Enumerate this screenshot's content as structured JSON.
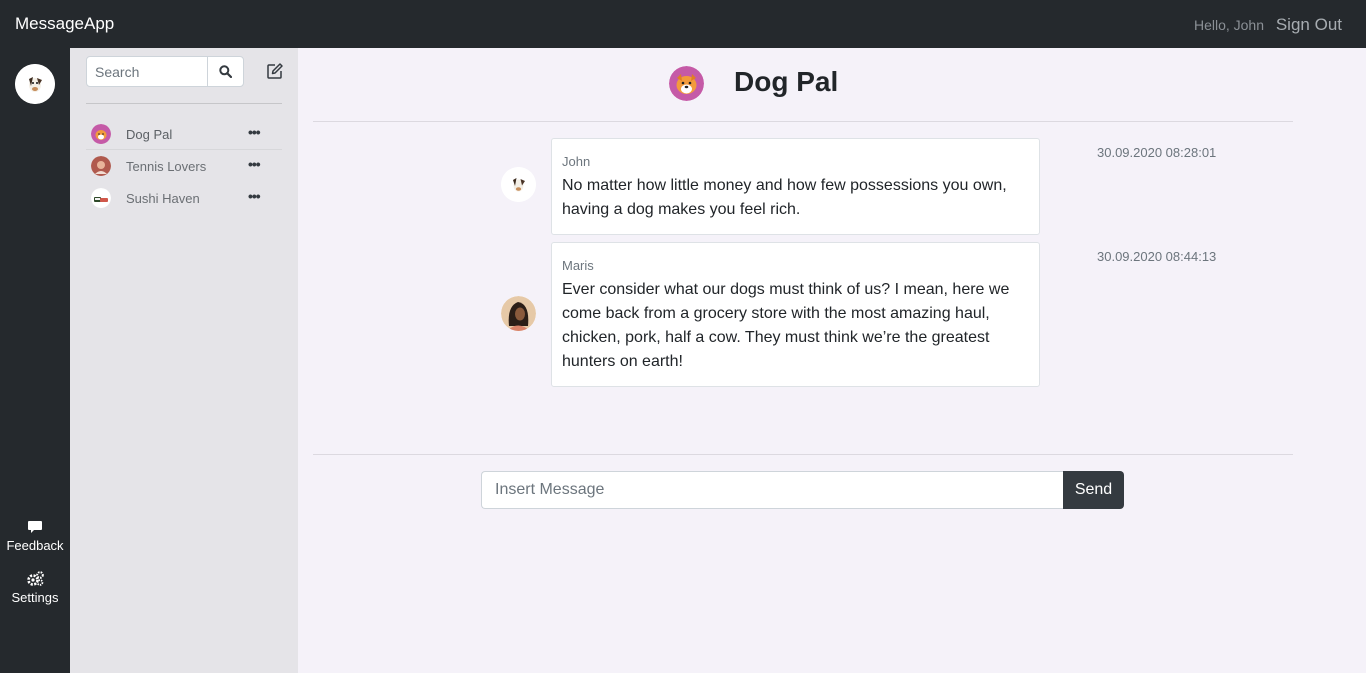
{
  "navbar": {
    "brand": "MessageApp",
    "greeting": "Hello, John",
    "sign_out": "Sign Out"
  },
  "rail": {
    "user_avatar_icon": "dog-avatar-icon",
    "feedback_label": "Feedback",
    "settings_label": "Settings"
  },
  "sidebar": {
    "search_placeholder": "Search",
    "search_icon": "search-icon",
    "compose_icon": "edit-icon",
    "chats": [
      {
        "name": "Dog Pal",
        "active": true,
        "icon": "dog-pal-avatar"
      },
      {
        "name": "Tennis Lovers",
        "active": false,
        "icon": "tennis-lovers-avatar"
      },
      {
        "name": "Sushi Haven",
        "active": false,
        "icon": "sushi-haven-avatar"
      }
    ],
    "more_label": "•••"
  },
  "conversation": {
    "title": "Dog Pal",
    "messages": [
      {
        "author": "John",
        "text": "No matter how little money and how few possessions you own, having a dog makes you feel rich.",
        "time": "30.09.2020 08:28:01"
      },
      {
        "author": "Maris",
        "text": "Ever consider what our dogs must think of us? I mean, here we come back from a grocery store with the most amazing haul, chicken, pork, half a cow. They must think we’re the greatest hunters on earth!",
        "time": "30.09.2020 08:44:13"
      }
    ],
    "input_placeholder": "Insert Message",
    "send_label": "Send"
  },
  "colors": {
    "navbar_bg": "#25292d",
    "panel_bg": "#e5e4e8",
    "main_bg": "#f5f2f9",
    "send_bg": "#343a40"
  }
}
